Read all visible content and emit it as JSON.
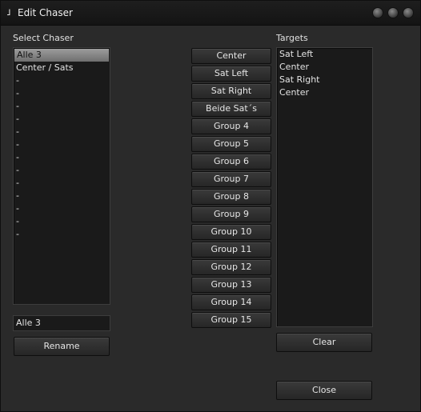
{
  "window": {
    "app_icon_glyph": "˩",
    "title": "Edit Chaser"
  },
  "left": {
    "label": "Select Chaser",
    "items": [
      "Alle 3",
      "Center / Sats",
      "-",
      "-",
      "-",
      "-",
      "-",
      "-",
      "-",
      "-",
      "-",
      "-",
      "-",
      "-",
      "-"
    ],
    "selected_index": 0,
    "name_value": "Alle 3",
    "rename_label": "Rename"
  },
  "middle": {
    "buttons": [
      "Center",
      "Sat Left",
      "Sat Right",
      "Beide Sat´s",
      "Group 4",
      "Group 5",
      "Group 6",
      "Group 7",
      "Group 8",
      "Group 9",
      "Group 10",
      "Group 11",
      "Group 12",
      "Group 13",
      "Group 14",
      "Group 15"
    ]
  },
  "right": {
    "label": "Targets",
    "items": [
      "Sat Left",
      "Center",
      "Sat Right",
      "Center"
    ],
    "clear_label": "Clear",
    "close_label": "Close"
  }
}
